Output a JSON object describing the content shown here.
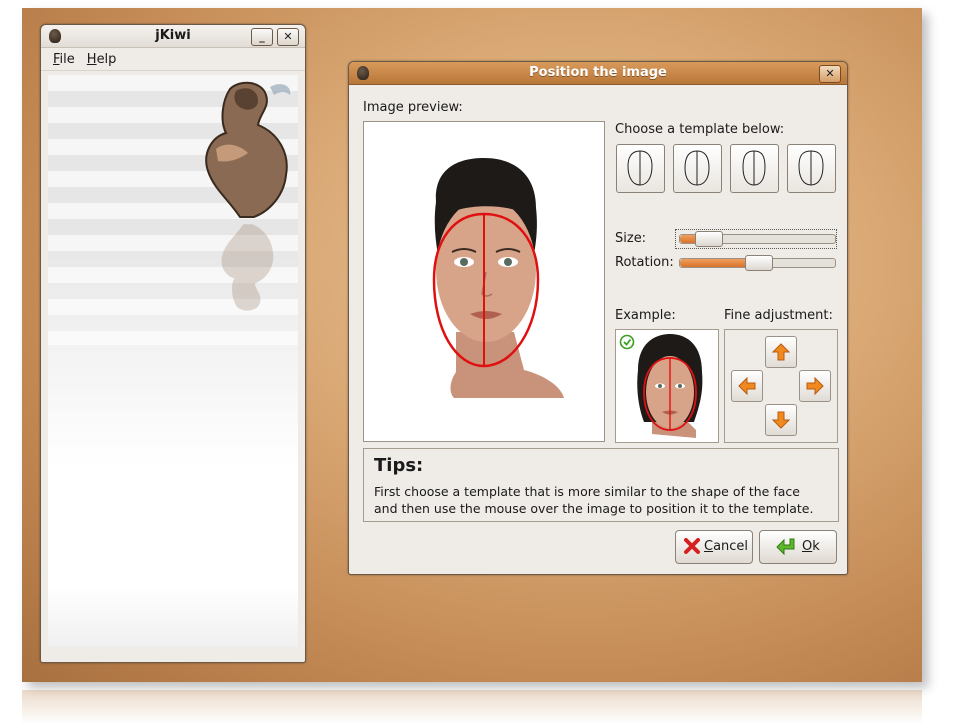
{
  "main_window": {
    "title": "jKiwi",
    "menu": [
      {
        "label": "File",
        "accel": "F",
        "rest": "ile"
      },
      {
        "label": "Help",
        "accel": "H",
        "rest": "elp"
      }
    ],
    "buttons": {
      "minimize": "_",
      "close": "✕"
    }
  },
  "dialog": {
    "title": "Position the image",
    "close": "✕",
    "image_preview_label": "Image preview:",
    "template_label": "Choose a template below:",
    "templates": [
      "template-1",
      "template-2",
      "template-3",
      "template-4"
    ],
    "size_label": "Size:",
    "size_value": 0.12,
    "rotation_label": "Rotation:",
    "rotation_value": 0.5,
    "example_label": "Example:",
    "fine_adjustment_label": "Fine adjustment:",
    "tips_title": "Tips:",
    "tips_line1": "First choose a template that is more similar to the shape of the face",
    "tips_line2": "and then use the mouse over the image to position it to the template.",
    "cancel_accel": "C",
    "cancel_rest": "ancel",
    "ok_accel": "O",
    "ok_rest": "k"
  },
  "colors": {
    "accent_orange": "#d9722a",
    "template_red": "#e01010",
    "titlebar_orange": "#c8874a",
    "check_green": "#3aa020"
  },
  "icons": [
    "app-icon",
    "minimize-icon",
    "close-icon",
    "arrow-up-icon",
    "arrow-left-icon",
    "arrow-right-icon",
    "arrow-down-icon",
    "cancel-x-icon",
    "ok-arrow-icon",
    "check-icon"
  ]
}
